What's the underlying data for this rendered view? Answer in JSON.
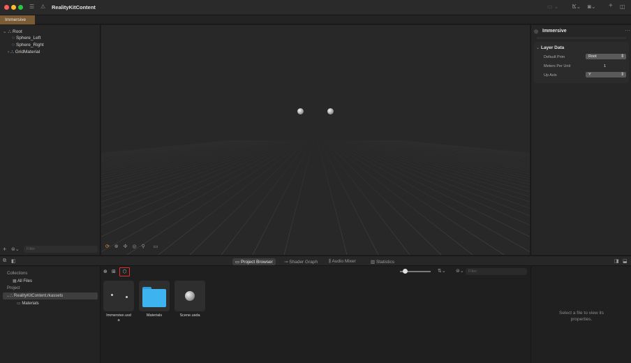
{
  "app": {
    "title": "RealityKitContent"
  },
  "tabs": [
    {
      "label": "Immersive"
    }
  ],
  "outline": {
    "items": [
      {
        "label": "Root"
      },
      {
        "label": "Sphere_Left"
      },
      {
        "label": "Sphere_Right"
      },
      {
        "label": "GridMaterial"
      }
    ],
    "filter_placeholder": "Filter"
  },
  "inspector": {
    "title": "Immersive",
    "section": "Layer Data",
    "fields": [
      {
        "label": "Default Prim",
        "value": "Root"
      },
      {
        "label": "Meters Per Unit",
        "value": "1"
      },
      {
        "label": "Up Axis",
        "value": "Y"
      }
    ]
  },
  "bottom_tabs": [
    {
      "label": "Project Browser"
    },
    {
      "label": "Shader Graph"
    },
    {
      "label": "Audio Mixer"
    },
    {
      "label": "Statistics"
    }
  ],
  "collections": {
    "header": "Collections",
    "all_files": "All Files",
    "project_header": "Project",
    "project": "RealityKitContent.rkassets",
    "materials": "Materials"
  },
  "browser": {
    "filter_placeholder": "Filter",
    "files": [
      {
        "name_line1": "Immersive.usd",
        "name_line2": "a"
      },
      {
        "name_line1": "Materials",
        "name_line2": ""
      },
      {
        "name_line1": "Scene.usda",
        "name_line2": ""
      }
    ]
  },
  "properties": {
    "empty_line1": "Select a file to view its",
    "empty_line2": "properties."
  },
  "colors": {
    "accent_tab": "#7b5a36",
    "folder": "#3db4f0",
    "highlight_box": "#e0302a"
  }
}
